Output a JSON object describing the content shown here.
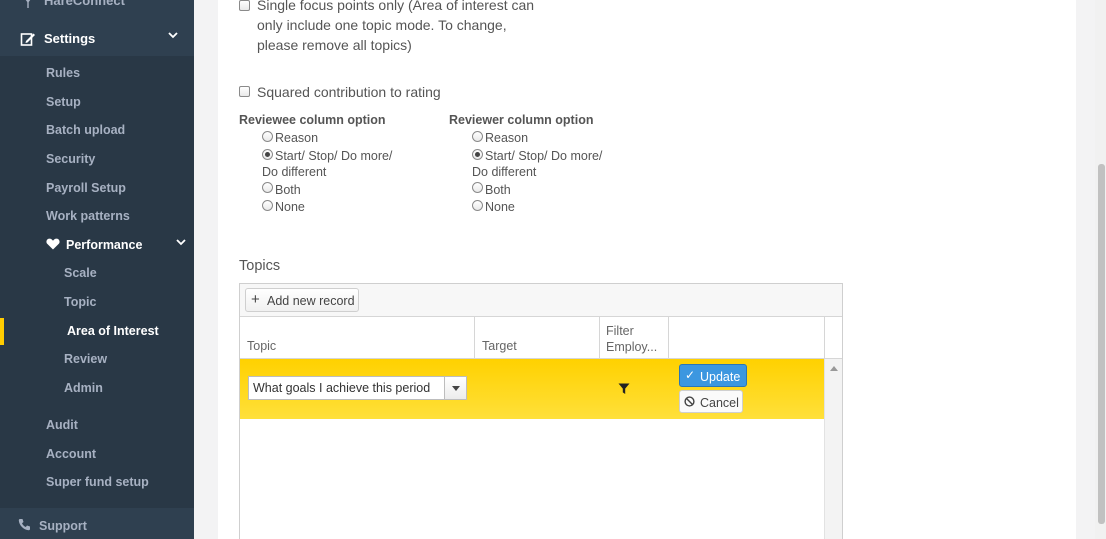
{
  "sidebar": {
    "top_partial_label": "HareConnect",
    "settings_label": "Settings",
    "items": [
      {
        "label": "Rules"
      },
      {
        "label": "Setup"
      },
      {
        "label": "Batch upload"
      },
      {
        "label": "Security"
      },
      {
        "label": "Payroll Setup"
      },
      {
        "label": "Work patterns"
      }
    ],
    "performance": {
      "label": "Performance",
      "children": [
        {
          "label": "Scale"
        },
        {
          "label": "Topic"
        },
        {
          "label": "Area of Interest"
        },
        {
          "label": "Review"
        },
        {
          "label": "Admin"
        }
      ]
    },
    "items_after": [
      {
        "label": "Audit"
      },
      {
        "label": "Account"
      },
      {
        "label": "Super fund setup"
      }
    ],
    "support_label": "Support",
    "active_item": "Area of Interest",
    "accent_color": "#ffcc00"
  },
  "form": {
    "single_focus_line1": "Single focus points only (Area of interest can",
    "single_focus_line2": "only include one topic mode. To change,",
    "single_focus_line3": "please remove all topics)",
    "single_focus_checked": false,
    "squared_label": "Squared contribution to rating",
    "squared_checked": false,
    "reviewee": {
      "title": "Reviewee column option",
      "options": [
        "Reason",
        "Start/ Stop/ Do more/",
        "Do different",
        "Both",
        "None"
      ],
      "selected": "Start/ Stop/ Do more/ Do different"
    },
    "reviewer": {
      "title": "Reviewer column option",
      "options": [
        "Reason",
        "Start/ Stop/ Do more/",
        "Do different",
        "Both",
        "None"
      ],
      "selected": "Start/ Stop/ Do more/ Do different"
    }
  },
  "topics": {
    "title": "Topics",
    "add_label": "Add new record",
    "columns": [
      "Topic",
      "Target",
      "Filter",
      "Employ..."
    ],
    "edit_row": {
      "topic_value": "What goals I achieve this period",
      "update_label": "Update",
      "cancel_label": "Cancel",
      "row_color": "#ffd100"
    }
  }
}
